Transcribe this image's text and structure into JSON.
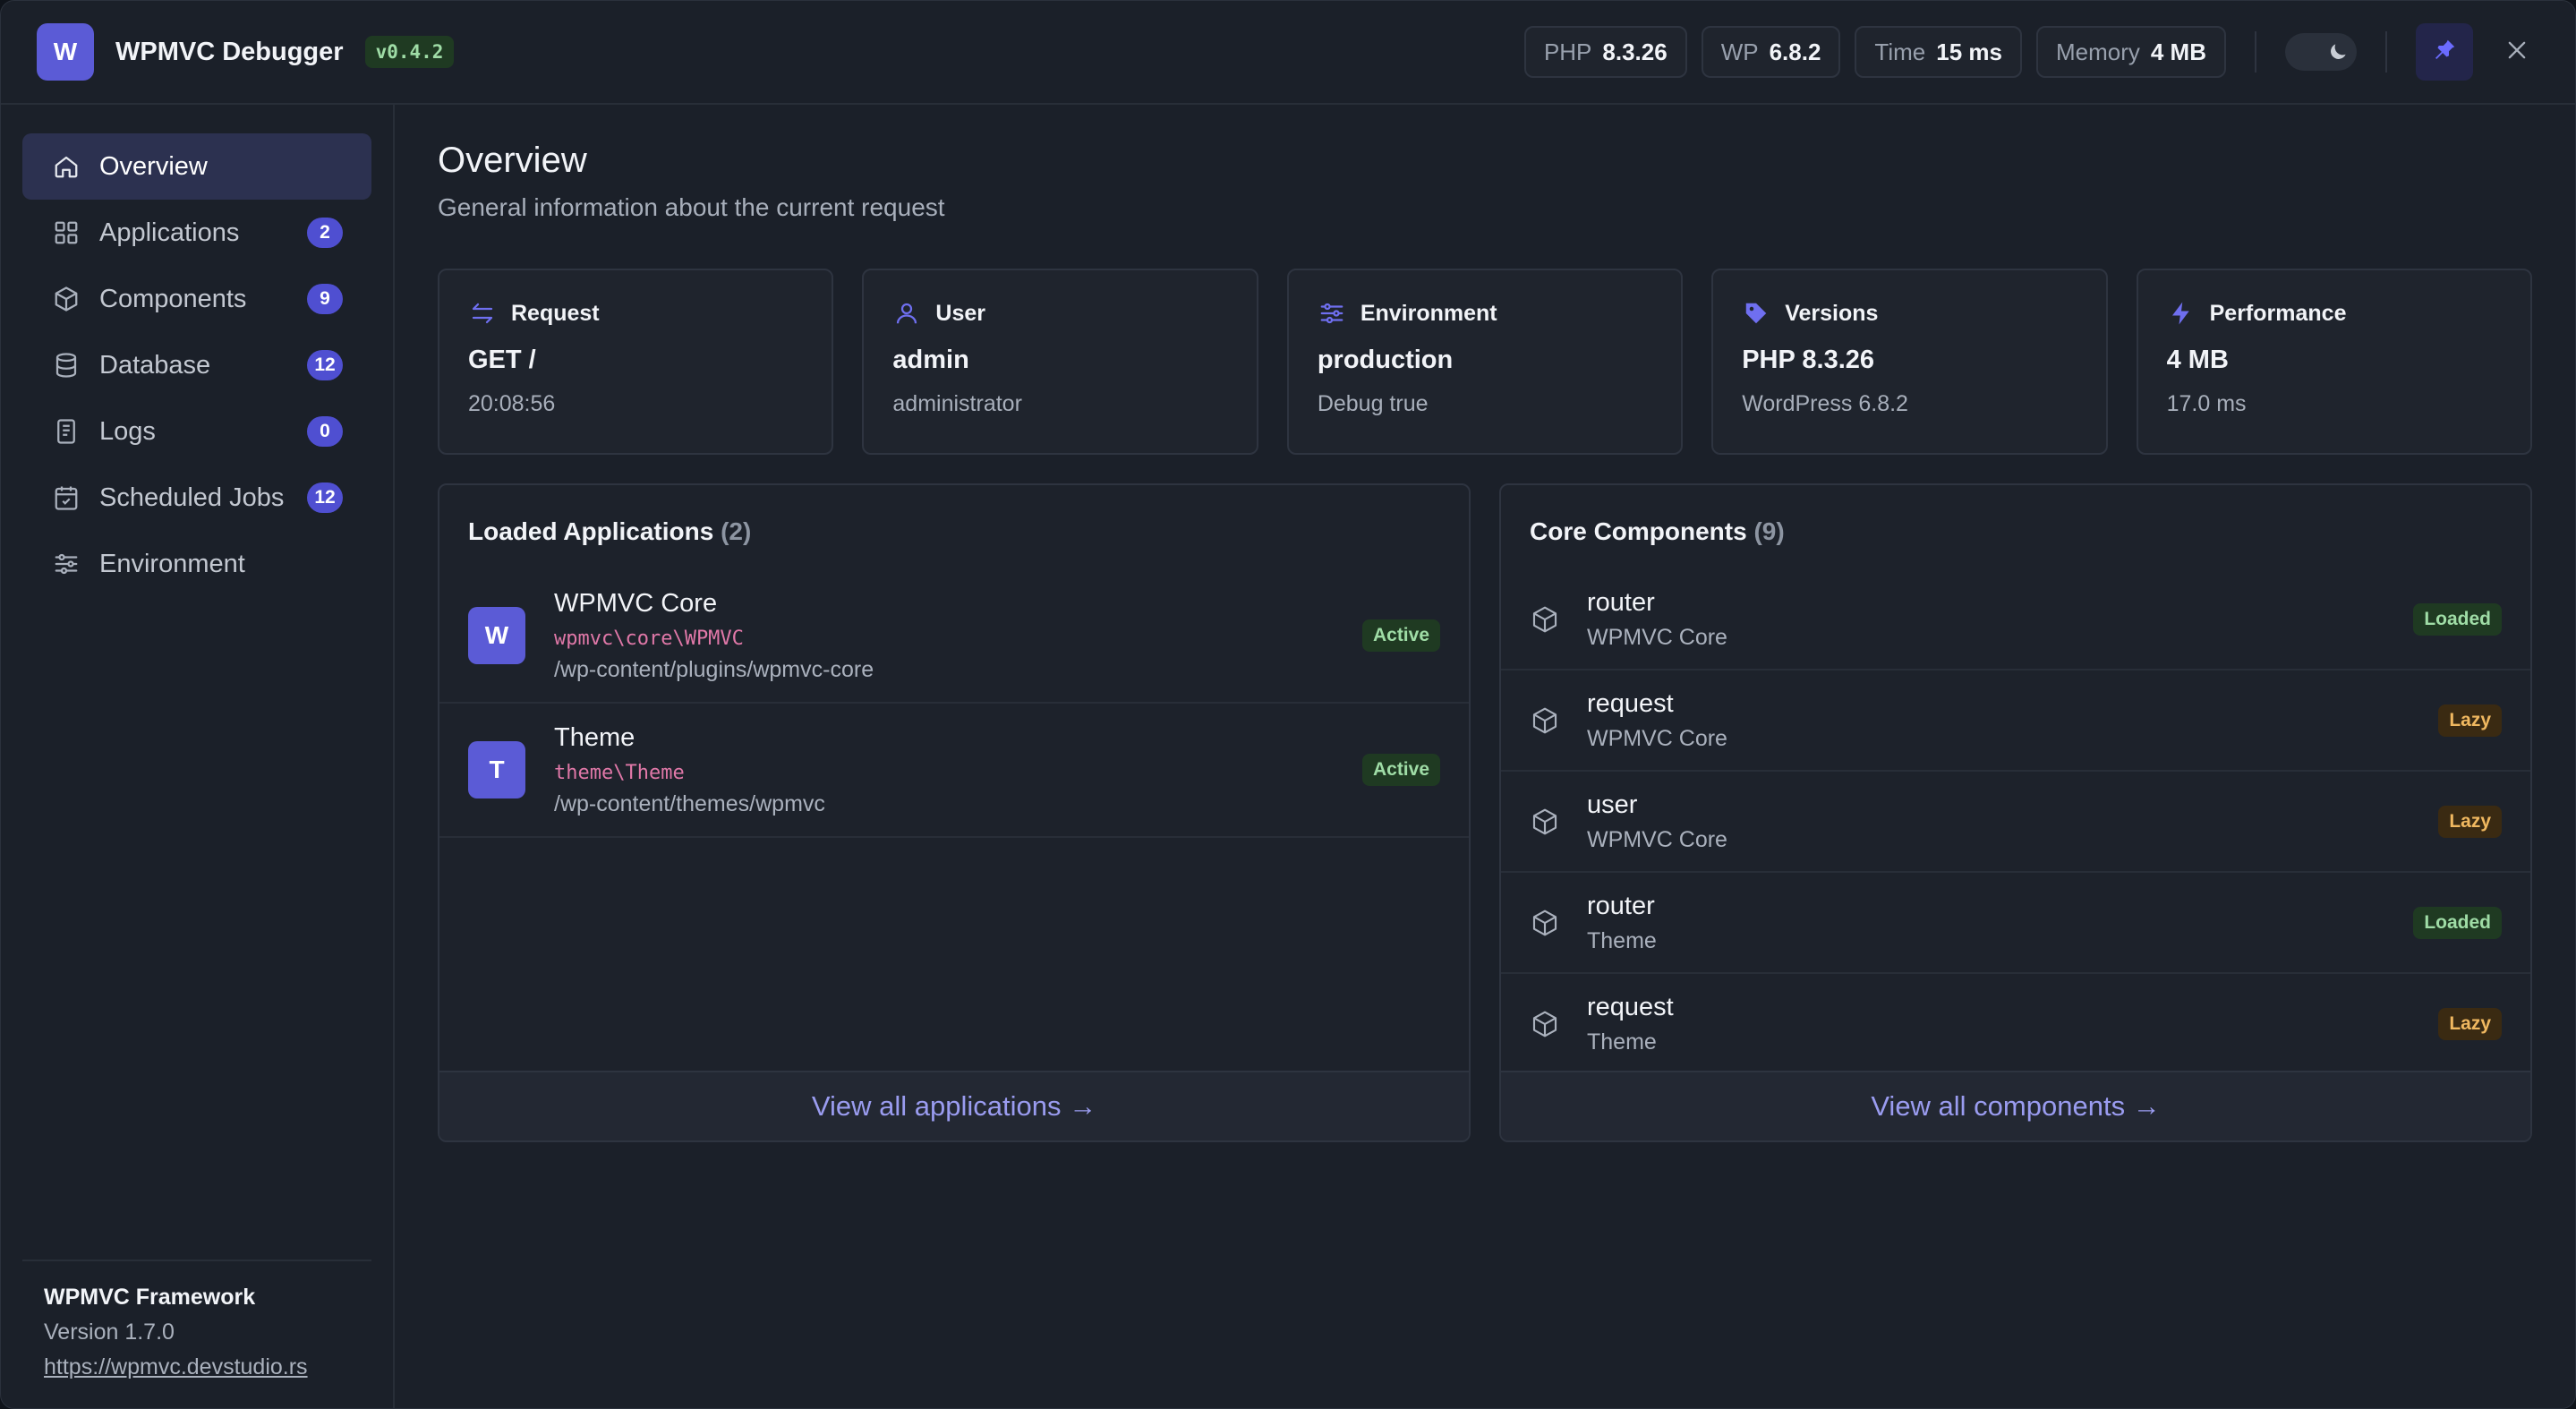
{
  "header": {
    "logo_letter": "W",
    "title": "WPMVC Debugger",
    "version": "v0.4.2",
    "stats": [
      {
        "key": "PHP",
        "value": "8.3.26"
      },
      {
        "key": "WP",
        "value": "6.8.2"
      },
      {
        "key": "Time",
        "value": "15 ms"
      },
      {
        "key": "Memory",
        "value": "4 MB"
      }
    ],
    "icons": {
      "theme_toggle": "moon-icon",
      "pin": "pin-icon",
      "close": "close-icon"
    }
  },
  "sidebar": {
    "items": [
      {
        "label": "Overview",
        "count": "",
        "icon": "home-icon",
        "active": true
      },
      {
        "label": "Applications",
        "count": "2",
        "icon": "grid-icon"
      },
      {
        "label": "Components",
        "count": "9",
        "icon": "cube-icon"
      },
      {
        "label": "Database",
        "count": "12",
        "icon": "database-icon"
      },
      {
        "label": "Logs",
        "count": "0",
        "icon": "document-icon"
      },
      {
        "label": "Scheduled Jobs",
        "count": "12",
        "icon": "calendar-icon"
      },
      {
        "label": "Environment",
        "count": "",
        "icon": "sliders-icon"
      }
    ],
    "footer": {
      "title": "WPMVC Framework",
      "version": "Version 1.7.0",
      "url": "https://wpmvc.devstudio.rs"
    }
  },
  "main": {
    "title": "Overview",
    "subtitle": "General information about the current request",
    "cards": [
      {
        "label": "Request",
        "value": "GET /",
        "sub": "20:08:56",
        "icon": "arrows-icon"
      },
      {
        "label": "User",
        "value": "admin",
        "sub": "administrator",
        "icon": "user-icon"
      },
      {
        "label": "Environment",
        "value": "production",
        "sub": "Debug true",
        "icon": "sliders-icon"
      },
      {
        "label": "Versions",
        "value": "PHP 8.3.26",
        "sub": "WordPress 6.8.2",
        "icon": "tag-icon"
      },
      {
        "label": "Performance",
        "value": "4 MB",
        "sub": "17.0 ms",
        "icon": "bolt-icon"
      }
    ],
    "applications": {
      "title": "Loaded Applications",
      "count": "(2)",
      "items": [
        {
          "letter": "W",
          "name": "WPMVC Core",
          "namespace": "wpmvc\\core\\WPMVC",
          "path": "/wp-content/plugins/wpmvc-core",
          "status": "Active"
        },
        {
          "letter": "T",
          "name": "Theme",
          "namespace": "theme\\Theme",
          "path": "/wp-content/themes/wpmvc",
          "status": "Active"
        }
      ],
      "footer_link": "View all applications →"
    },
    "components": {
      "title": "Core Components",
      "count": "(9)",
      "items": [
        {
          "name": "router",
          "app": "WPMVC Core",
          "status": "Loaded"
        },
        {
          "name": "request",
          "app": "WPMVC Core",
          "status": "Lazy"
        },
        {
          "name": "user",
          "app": "WPMVC Core",
          "status": "Lazy"
        },
        {
          "name": "router",
          "app": "Theme",
          "status": "Loaded"
        },
        {
          "name": "request",
          "app": "Theme",
          "status": "Lazy"
        }
      ],
      "footer_link": "View all components →"
    }
  },
  "colors": {
    "accent": "#5b5bd6",
    "active_green": "#9fdca6",
    "lazy_amber": "#f0b860"
  }
}
